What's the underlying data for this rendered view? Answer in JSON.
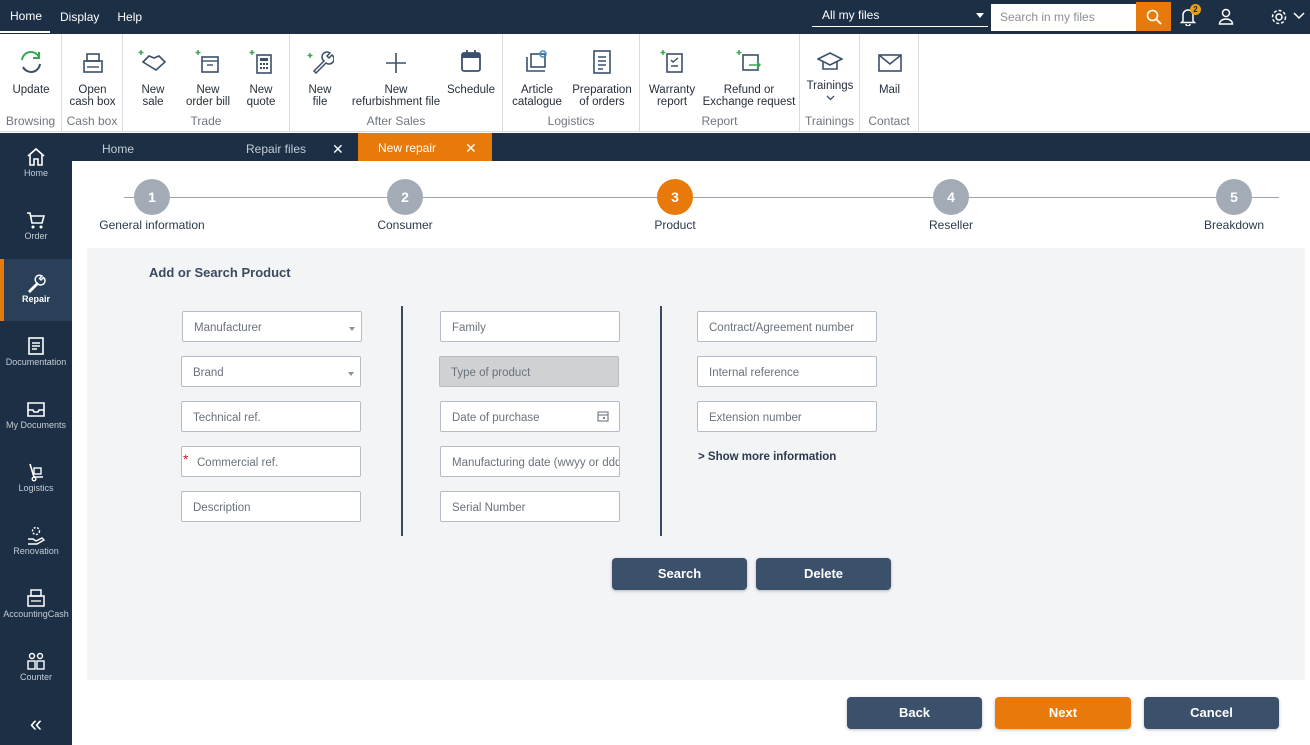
{
  "menu": {
    "items": [
      "Home",
      "Display",
      "Help"
    ]
  },
  "search": {
    "scope": "All my files",
    "placeholder": "Search in my files",
    "notifications": "2"
  },
  "ribbon": {
    "groups": [
      "Browsing",
      "Cash box",
      "Trade",
      "After Sales",
      "Logistics",
      "Report",
      "Trainings",
      "Contact"
    ],
    "buttons": {
      "update": "Update",
      "open_cash_box": [
        "Open",
        "cash box"
      ],
      "new_sale": [
        "New",
        "sale"
      ],
      "new_order_bill": [
        "New",
        "order bill"
      ],
      "new_quote": [
        "New",
        "quote"
      ],
      "new_file": [
        "New",
        "file"
      ],
      "new_refurbishment_file": [
        "New",
        "refurbishment file"
      ],
      "schedule": "Schedule",
      "article_catalogue": [
        "Article",
        "catalogue"
      ],
      "preparation_of_orders": [
        "Preparation",
        "of orders"
      ],
      "warranty_report": [
        "Warranty",
        "report"
      ],
      "refund_or_exchange": [
        "Refund or",
        "Exchange request"
      ],
      "trainings": "Trainings",
      "mail": "Mail"
    }
  },
  "sidebar": {
    "items": [
      {
        "label": "Home",
        "icon": "home-icon"
      },
      {
        "label": "Order",
        "icon": "cart-icon"
      },
      {
        "label": "Repair",
        "icon": "wrench-icon"
      },
      {
        "label": "Documentation",
        "icon": "document-icon"
      },
      {
        "label": "My Documents",
        "icon": "inbox-icon"
      },
      {
        "label": "Logistics",
        "icon": "hand-truck-icon"
      },
      {
        "label": "Renovation",
        "icon": "gear-hand-icon"
      },
      {
        "label": "AccountingCash",
        "icon": "cash-register-icon"
      },
      {
        "label": "Counter",
        "icon": "people-icon"
      }
    ],
    "active": "Repair",
    "collapse": "«"
  },
  "tabs": [
    {
      "label": "Home",
      "closable": false
    },
    {
      "label": "Repair files",
      "closable": true
    },
    {
      "label": "New repair",
      "closable": true,
      "active": true
    }
  ],
  "close_glyph": "✕",
  "stepper": {
    "steps": [
      {
        "number": "1",
        "label": "General information"
      },
      {
        "number": "2",
        "label": "Consumer"
      },
      {
        "number": "3",
        "label": "Product"
      },
      {
        "number": "4",
        "label": "Reseller"
      },
      {
        "number": "5",
        "label": "Breakdown"
      }
    ],
    "current": 3
  },
  "form": {
    "title": "Add or Search Product",
    "manufacturer": "Manufacturer",
    "brand": "Brand",
    "technical_ref": "Technical ref.",
    "commercial_ref": "Commercial ref.",
    "required_mark": "*",
    "description": "Description",
    "family": "Family",
    "type_of_product": "Type of product",
    "date_of_purchase": "Date of purchase",
    "manufacturing_date": "Manufacturing date (wwyy or dddyy)",
    "serial_number": "Serial Number",
    "contract_number": "Contract/Agreement number",
    "internal_reference": "Internal reference",
    "extension_number": "Extension number",
    "show_more": "> Show more information",
    "search_button": "Search",
    "delete_button": "Delete"
  },
  "footer": {
    "back": "Back",
    "next": "Next",
    "cancel": "Cancel"
  },
  "colors": {
    "navy": "#1c2f45",
    "accent": "#e87a0c",
    "button": "#3a506b"
  }
}
